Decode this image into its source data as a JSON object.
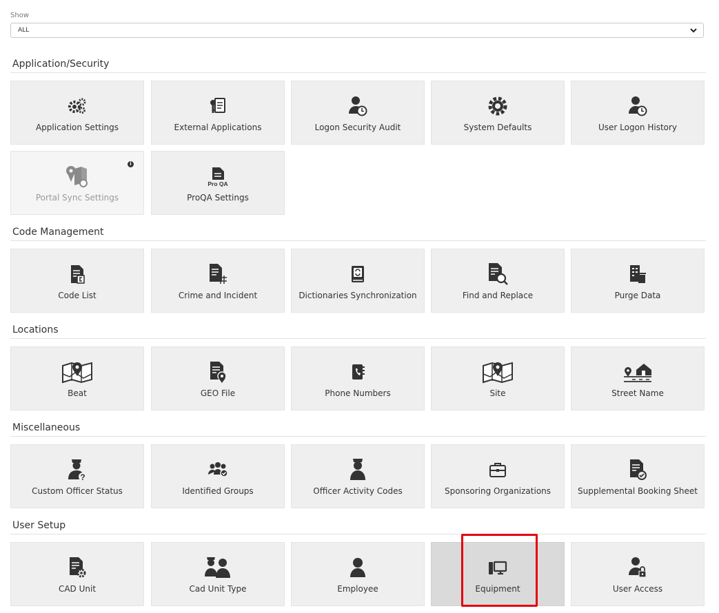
{
  "filter": {
    "label": "Show",
    "value": "ALL"
  },
  "sections": [
    {
      "title": "Application/Security",
      "tiles": [
        {
          "label": "Application Settings",
          "icon": "gears-icon"
        },
        {
          "label": "External Applications",
          "icon": "user-key-clipboard-icon"
        },
        {
          "label": "Logon Security Audit",
          "icon": "user-clock-icon"
        },
        {
          "label": "System Defaults",
          "icon": "gear-icon"
        },
        {
          "label": "User Logon History",
          "icon": "user-clock-icon"
        },
        {
          "label": "Portal Sync Settings",
          "icon": "map-sync-icon",
          "disabled": true,
          "badge": "i"
        },
        {
          "label": "ProQA Settings",
          "icon": "proqa-document-icon",
          "icon_text": "Pro QA"
        }
      ]
    },
    {
      "title": "Code Management",
      "tiles": [
        {
          "label": "Code List",
          "icon": "code-list-document-icon"
        },
        {
          "label": "Crime and Incident",
          "icon": "crime-document-icon"
        },
        {
          "label": "Dictionaries Synchronization",
          "icon": "sync-book-icon"
        },
        {
          "label": "Find and Replace",
          "icon": "document-search-icon"
        },
        {
          "label": "Purge Data",
          "icon": "purge-data-icon"
        }
      ]
    },
    {
      "title": "Locations",
      "tiles": [
        {
          "label": "Beat",
          "icon": "map-marker-icon"
        },
        {
          "label": "GEO File",
          "icon": "geo-document-icon"
        },
        {
          "label": "Phone Numbers",
          "icon": "phone-book-icon"
        },
        {
          "label": "Site",
          "icon": "map-marker-icon"
        },
        {
          "label": "Street Name",
          "icon": "street-house-icon"
        }
      ]
    },
    {
      "title": "Miscellaneous",
      "tiles": [
        {
          "label": "Custom Officer Status",
          "icon": "officer-question-icon"
        },
        {
          "label": "Identified Groups",
          "icon": "users-check-icon"
        },
        {
          "label": "Officer Activity Codes",
          "icon": "officer-icon"
        },
        {
          "label": "Sponsoring Organizations",
          "icon": "briefcase-icon"
        },
        {
          "label": "Supplemental Booking Sheet",
          "icon": "document-check-icon"
        }
      ]
    },
    {
      "title": "User Setup",
      "tiles": [
        {
          "label": "CAD Unit",
          "icon": "document-gear-icon"
        },
        {
          "label": "Cad Unit Type",
          "icon": "officers-icon"
        },
        {
          "label": "Employee",
          "icon": "user-icon"
        },
        {
          "label": "Equipment",
          "icon": "computer-icon",
          "selected": true
        },
        {
          "label": "User Access",
          "icon": "user-lock-icon"
        }
      ]
    }
  ],
  "colors": {
    "tile_bg": "#efefef",
    "tile_selected_bg": "#dadada",
    "highlight": "#e3000f",
    "icon": "#333333"
  }
}
